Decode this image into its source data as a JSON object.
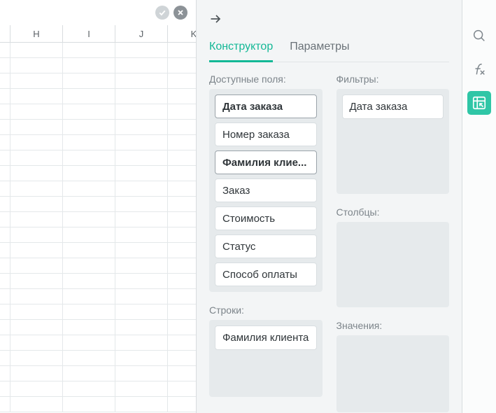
{
  "sheet": {
    "columns": [
      "H",
      "I",
      "J",
      "K"
    ]
  },
  "panel": {
    "tabs": {
      "constructor": "Конструктор",
      "parameters": "Параметры"
    },
    "labels": {
      "available": "Доступные поля:",
      "filters": "Фильтры:",
      "columns": "Столбцы:",
      "rows": "Строки:",
      "values": "Значения:"
    },
    "fields": {
      "order_date": "Дата заказа",
      "order_number": "Номер заказа",
      "lastname_short": "Фамилия клие...",
      "order": "Заказ",
      "cost": "Стоимость",
      "status": "Статус",
      "payment": "Способ оплаты"
    },
    "filter_items": {
      "f0": "Дата заказа"
    },
    "row_items": {
      "r0": "Фамилия клиента"
    }
  }
}
